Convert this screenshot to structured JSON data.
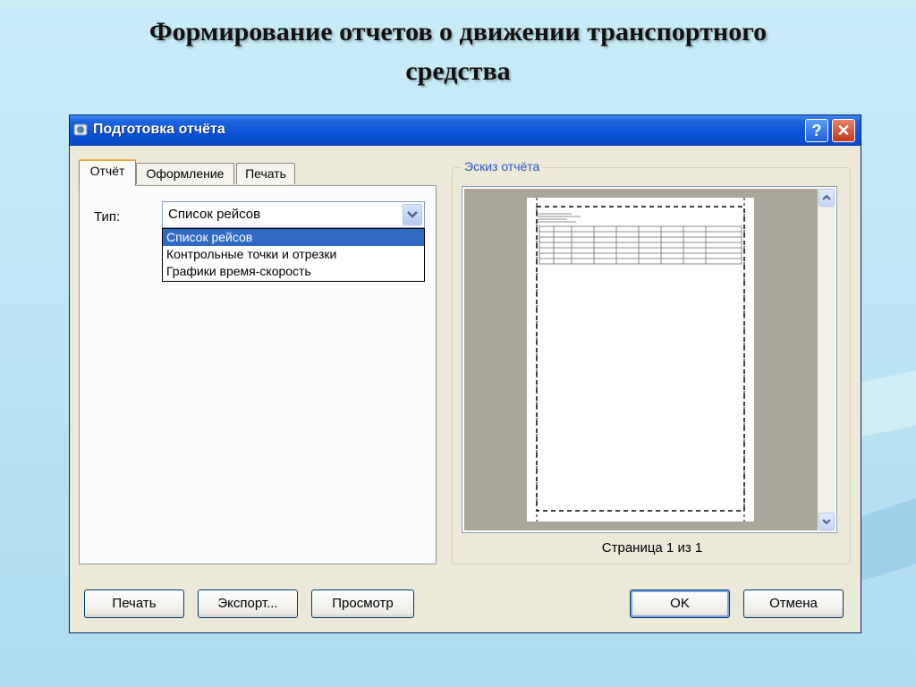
{
  "slide": {
    "title_line1": "Формирование отчетов о движении транспортного",
    "title_line2": "средства"
  },
  "window": {
    "title": "Подготовка отчёта",
    "help_label": "?",
    "close_label": "✕"
  },
  "tabs": [
    {
      "label": "Отчёт",
      "active": true
    },
    {
      "label": "Оформление",
      "active": false
    },
    {
      "label": "Печать",
      "active": false
    }
  ],
  "report_tab": {
    "type_label": "Тип:",
    "selected_value": "Список рейсов",
    "options": [
      "Список рейсов",
      "Контрольные точки и отрезки",
      "Графики время-скорость"
    ]
  },
  "preview": {
    "legend": "Эскиз отчёта",
    "page_label": "Страница 1 из 1"
  },
  "buttons": {
    "print": "Печать",
    "export": "Экспорт...",
    "preview": "Просмотр",
    "ok": "OK",
    "cancel": "Отмена"
  },
  "colors": {
    "titlebar": "#0a52d8",
    "selection": "#316ac5",
    "legend_text": "#2a55c9"
  }
}
